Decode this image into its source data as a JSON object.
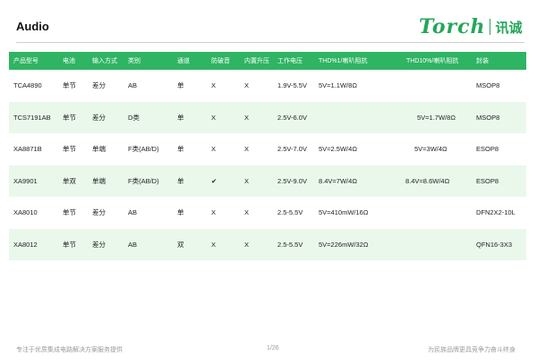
{
  "title": "Audio",
  "logo": {
    "word": "Torch",
    "cn": "讯诚"
  },
  "table": {
    "header_bg": "#2fb463",
    "alt_row_bg": "#eaf8ec",
    "columns": [
      "产品型号",
      "电池",
      "输入方式",
      "类别",
      "通道",
      "防破音",
      "内置升压",
      "工作电压",
      "THD%1/喇叭阻抗",
      "THD10%/喇叭阻抗",
      "封装"
    ],
    "rows": [
      [
        "TCA4890",
        "单节",
        "差分",
        "AB",
        "单",
        "X",
        "X",
        "1.9V-5.5V",
        "5V=1.1W/8Ω",
        "",
        "MSOP8"
      ],
      [
        "TCS7191AB",
        "单节",
        "差分",
        "D类",
        "单",
        "X",
        "X",
        "2.5V-6.0V",
        "",
        "5V=1.7W/8Ω",
        "MSOP8"
      ],
      [
        "XA8871B",
        "单节",
        "单端",
        "F类(AB/D)",
        "单",
        "X",
        "X",
        "2.5V-7.0V",
        "5V=2.5W/4Ω",
        "5V=3W/4Ω",
        "ESOP8"
      ],
      [
        "XA9901",
        "单双",
        "单端",
        "F类(AB/D)",
        "单",
        "✔",
        "X",
        "2.5V-9.0V",
        "8.4V=7W/4Ω",
        "8.4V=8.6W/4Ω",
        "ESOP8"
      ],
      [
        "XA8010",
        "单节",
        "差分",
        "AB",
        "单",
        "X",
        "X",
        "2.5-5.5V",
        "5V=410mW/16Ω",
        "",
        "DFN2X2-10L"
      ],
      [
        "XA8012",
        "单节",
        "差分",
        "AB",
        "双",
        "X",
        "X",
        "2.5-5.5V",
        "5V=226mW/32Ω",
        "",
        "QFN16-3X3"
      ]
    ]
  },
  "footer": {
    "left": "专注于优质集成电路解决方案服务提供",
    "page": "1/26",
    "right": "为民族品牌更具竞争力奋斗终身"
  }
}
